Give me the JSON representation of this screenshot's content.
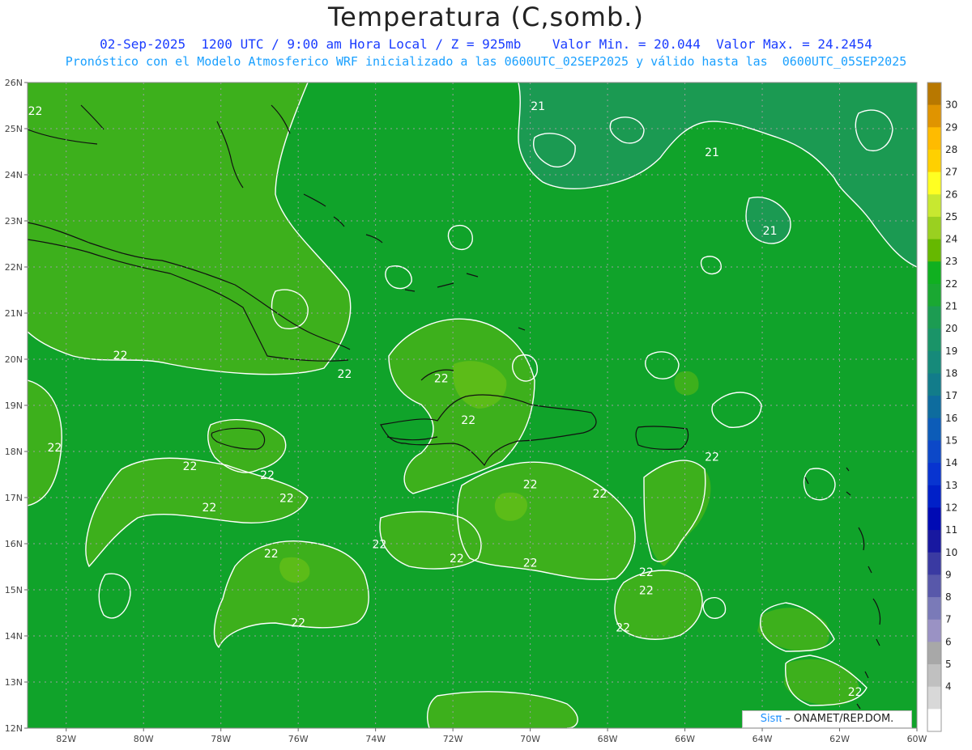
{
  "header": {
    "title": "Temperatura (C,somb.)",
    "line1": "02-Sep-2025  1200 UTC / 9:00 am Hora Local / Z = 925mb    Valor Min. = 20.044  Valor Max. = 24.2454",
    "line2": "Pronóstico con el Modelo Atmosferico WRF inicializado a las 0600UTC_02SEP2025 y válido hasta las  0600UTC_05SEP2025"
  },
  "map": {
    "variable": "Temperatura",
    "units": "C",
    "level": "925mb",
    "lon_range": [
      -83,
      -60
    ],
    "lat_range": [
      12,
      26
    ],
    "lon_ticks": [
      "82W",
      "80W",
      "78W",
      "76W",
      "74W",
      "72W",
      "70W",
      "68W",
      "66W",
      "64W",
      "62W",
      "60W"
    ],
    "lat_ticks": [
      "26N",
      "25N",
      "24N",
      "23N",
      "22N",
      "21N",
      "20N",
      "19N",
      "18N",
      "17N",
      "16N",
      "15N",
      "14N",
      "13N",
      "12N"
    ],
    "contour_labels": [
      {
        "text": "22",
        "lon": -82.8,
        "lat": 25.3
      },
      {
        "text": "21",
        "lon": -69.8,
        "lat": 25.4
      },
      {
        "text": "21",
        "lon": -65.3,
        "lat": 24.4
      },
      {
        "text": "21",
        "lon": -63.8,
        "lat": 22.7
      },
      {
        "text": "22",
        "lon": -80.6,
        "lat": 20.0
      },
      {
        "text": "22",
        "lon": -74.8,
        "lat": 19.6
      },
      {
        "text": "22",
        "lon": -72.3,
        "lat": 19.5
      },
      {
        "text": "22",
        "lon": -71.6,
        "lat": 18.6
      },
      {
        "text": "22",
        "lon": -82.3,
        "lat": 18.0
      },
      {
        "text": "22",
        "lon": -78.8,
        "lat": 17.6
      },
      {
        "text": "22",
        "lon": -76.8,
        "lat": 17.4
      },
      {
        "text": "22",
        "lon": -70.0,
        "lat": 17.2
      },
      {
        "text": "22",
        "lon": -68.2,
        "lat": 17.0
      },
      {
        "text": "22",
        "lon": -65.3,
        "lat": 17.8
      },
      {
        "text": "22",
        "lon": -78.3,
        "lat": 16.7
      },
      {
        "text": "22",
        "lon": -76.3,
        "lat": 16.9
      },
      {
        "text": "22",
        "lon": -76.7,
        "lat": 15.7
      },
      {
        "text": "22",
        "lon": -73.9,
        "lat": 15.9
      },
      {
        "text": "22",
        "lon": -71.9,
        "lat": 15.6
      },
      {
        "text": "22",
        "lon": -70.0,
        "lat": 15.5
      },
      {
        "text": "22",
        "lon": -67.0,
        "lat": 15.3
      },
      {
        "text": "22",
        "lon": -67.0,
        "lat": 14.9
      },
      {
        "text": "22",
        "lon": -76.0,
        "lat": 14.2
      },
      {
        "text": "22",
        "lon": -67.6,
        "lat": 14.1
      },
      {
        "text": "22",
        "lon": -61.6,
        "lat": 12.7
      }
    ]
  },
  "colorbar": {
    "levels": [
      "30",
      "29",
      "28",
      "27",
      "26",
      "25",
      "24",
      "23",
      "22",
      "21",
      "20",
      "19",
      "18",
      "17",
      "16",
      "15",
      "14",
      "13",
      "12",
      "11",
      "10",
      "9",
      "8",
      "7",
      "6",
      "5",
      "4"
    ],
    "colors": [
      "#b87800",
      "#e09400",
      "#ffbb00",
      "#ffd000",
      "#ffff22",
      "#e0f048",
      "#b8e030",
      "#92d020",
      "#66b800",
      "#10b020",
      "#1cac2e",
      "#1ca04a",
      "#1c9868",
      "#158a7a",
      "#0c7a8c",
      "#0a6aa8",
      "#1050c0",
      "#0a38d0",
      "#0018c8",
      "#0000b0",
      "#1a1aa8",
      "#2828a0",
      "#4848a8",
      "#6868b0",
      "#8888c0",
      "#a8a0c8",
      "#a6a6a6"
    ],
    "swatches": [
      "#b87800",
      "#e09400",
      "#ffbb00",
      "#ffd000",
      "#ffff22",
      "#c8e830",
      "#9ad020",
      "#66b800",
      "#10b020",
      "#1aa832",
      "#1c9c52",
      "#1a9468",
      "#168a7a",
      "#127c8a",
      "#0e6c9e",
      "#0c5cb8",
      "#0c48c8",
      "#0834d0",
      "#0020c8",
      "#000ab4",
      "#1818a0",
      "#3a3aa2",
      "#5858aa",
      "#7a7ab8",
      "#9a92c4",
      "#a8a8a8",
      "#c0c0c0",
      "#d8d8d8",
      "#ffffff"
    ],
    "swatch_labels": [
      "",
      "30",
      "29",
      "28",
      "27",
      "26",
      "25",
      "24",
      "23",
      "22",
      "21",
      "20",
      "19",
      "18",
      "17",
      "16",
      "15",
      "14",
      "13",
      "12",
      "11",
      "10",
      "9",
      "8",
      "7",
      "6",
      "5",
      "4",
      ""
    ]
  },
  "credit": {
    "sis": "Sisπ",
    "org": " – ONAMET/REP.DOM."
  }
}
